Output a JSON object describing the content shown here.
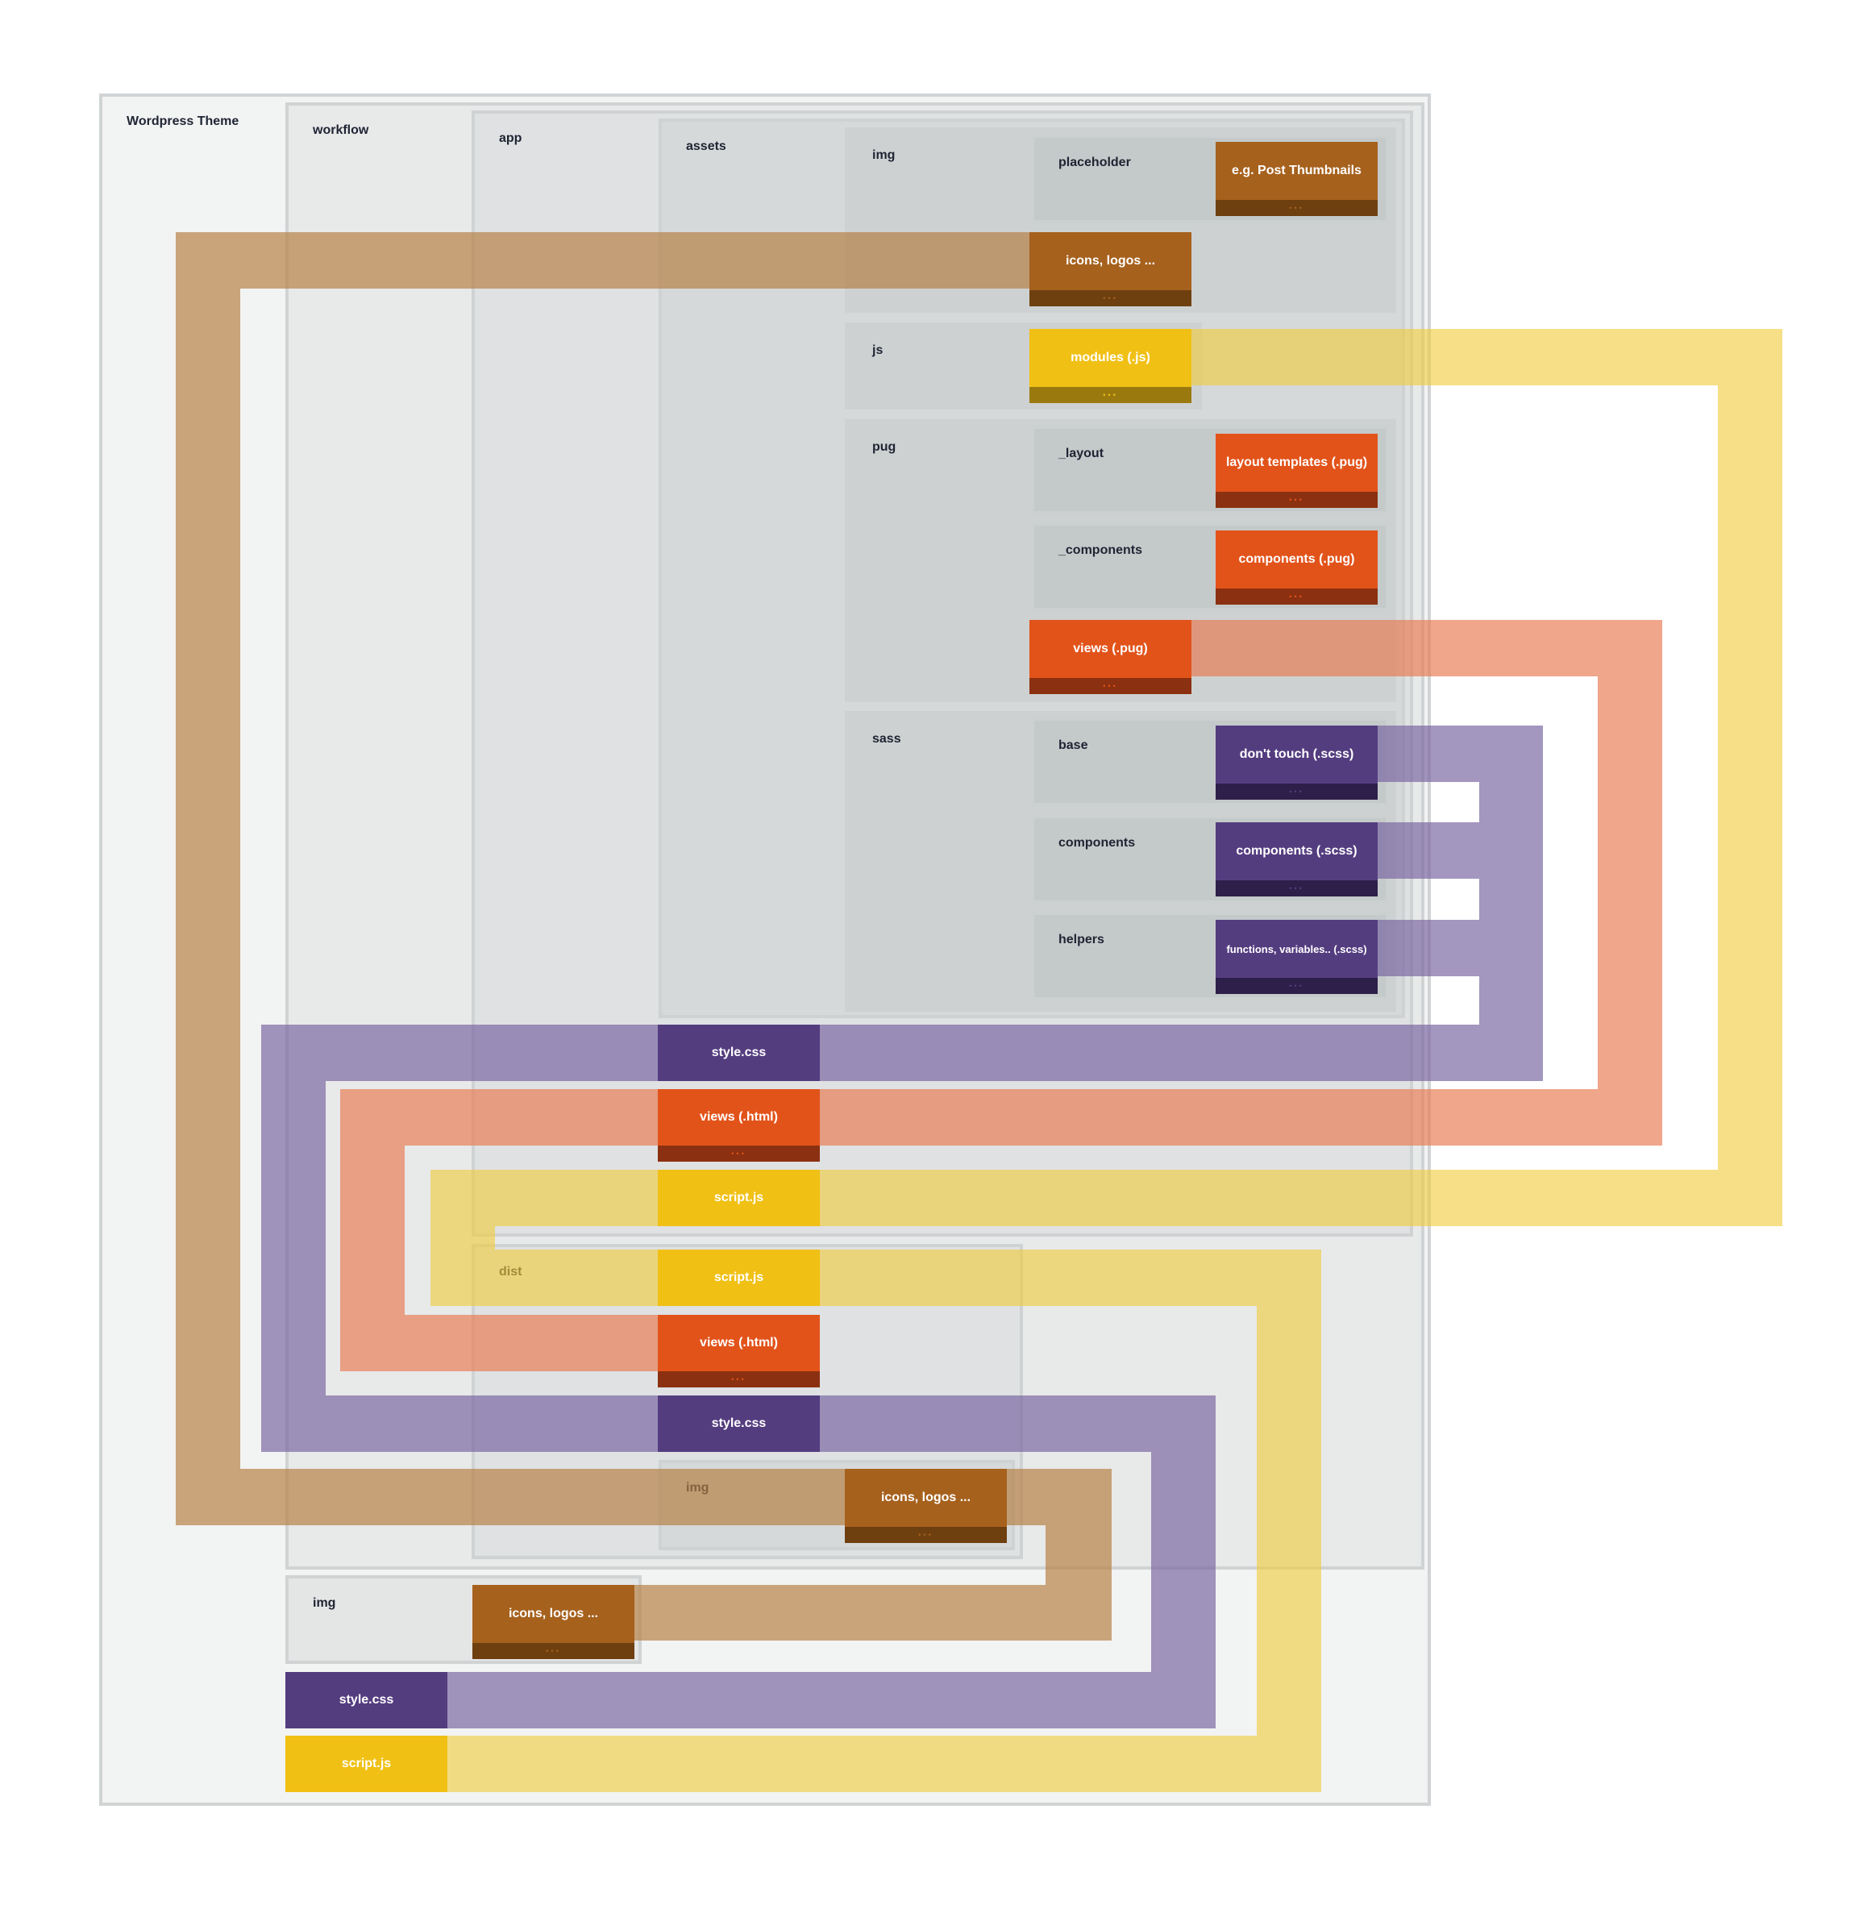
{
  "colors": {
    "img": "#a6611d",
    "img_dark": "#6e4010",
    "img_band": "rgba(182,127,66,0.68)",
    "js": "#f0c015",
    "js_dark": "#9a7a0f",
    "js_band": "rgba(241,204,60,0.62)",
    "pug": "#e2531a",
    "pug_dark": "#8b3010",
    "pug_band": "rgba(232,124,82,0.68)",
    "sass": "#543d7f",
    "sass_dark": "#2e1f4a",
    "sass_band": "rgba(120,100,160,0.68)"
  },
  "folders": {
    "theme": "Wordpress Theme",
    "workflow": "workflow",
    "app": "app",
    "assets": "assets",
    "img": "img",
    "placeholder": "placeholder",
    "js": "js",
    "pug": "pug",
    "layout": "_layout",
    "components_pug": "_components",
    "sass": "sass",
    "base": "base",
    "components_sass": "components",
    "helpers": "helpers",
    "dist": "dist",
    "dist_img": "img",
    "root_img": "img"
  },
  "files": {
    "post_thumbnails": "e.g. Post Thumbnails",
    "icons_assets": "icons, logos ...",
    "modules_js": "modules (.js)",
    "layout_templates": "layout templates (.pug)",
    "components_pug": "components (.pug)",
    "views_pug": "views (.pug)",
    "dont_touch": "don't touch (.scss)",
    "components_scss": "components (.scss)",
    "functions": "functions, variables.. (.scss)",
    "app_style": "style.css",
    "app_views": "views (.html)",
    "app_script": "script.js",
    "dist_script": "script.js",
    "dist_views": "views (.html)",
    "dist_style": "style.css",
    "dist_icons": "icons, logos ...",
    "root_icons": "icons, logos ...",
    "root_style": "style.css",
    "root_script": "script.js"
  },
  "more_indicator": "•••"
}
